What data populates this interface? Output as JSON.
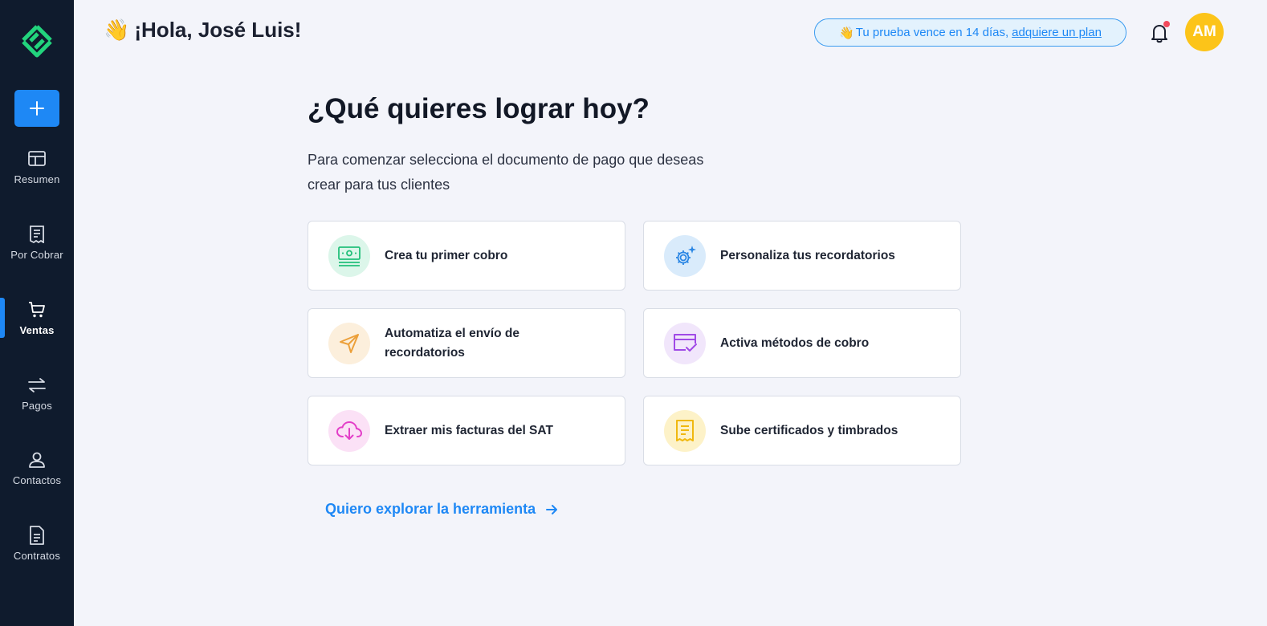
{
  "sidebar": {
    "logo_icon": "diamond-logo-icon",
    "add_icon": "plus-icon",
    "items": [
      {
        "label": "Resumen",
        "icon": "layout-icon"
      },
      {
        "label": "Por Cobrar",
        "icon": "receipt-icon"
      },
      {
        "label": "Ventas",
        "icon": "cart-icon",
        "active": true
      },
      {
        "label": "Pagos",
        "icon": "transfer-arrows-icon"
      },
      {
        "label": "Contactos",
        "icon": "user-icon"
      },
      {
        "label": "Contratos",
        "icon": "document-icon"
      }
    ]
  },
  "header": {
    "greeting_emoji": "👋",
    "greeting": "¡Hola, José Luis!",
    "trial_emoji": "👋",
    "trial_text": "Tu prueba vence en 14 días,",
    "trial_link": "adquiere un plan",
    "avatar_initials": "AM"
  },
  "main": {
    "title": "¿Qué quieres lograr hoy?",
    "subtitle": "Para comenzar selecciona el documento de pago que deseas crear para tus clientes",
    "cards": [
      {
        "label": "Crea tu primer cobro",
        "icon": "money-bill-icon"
      },
      {
        "label": "Personaliza tus recordatorios",
        "icon": "gear-sparkle-icon"
      },
      {
        "label": "Automatiza el envío de recordatorios",
        "icon": "send-plane-icon"
      },
      {
        "label": "Activa métodos de cobro",
        "icon": "card-check-icon"
      },
      {
        "label": "Extraer mis facturas del SAT",
        "icon": "cloud-download-icon"
      },
      {
        "label": "Sube certificados y timbrados",
        "icon": "receipt-doc-icon"
      }
    ],
    "explore_link": "Quiero explorar la herramienta"
  },
  "colors": {
    "sidebar_bg": "#0f1b2d",
    "accent": "#1e88f5",
    "page_bg": "#f3f4fa",
    "avatar": "#fcc419"
  }
}
